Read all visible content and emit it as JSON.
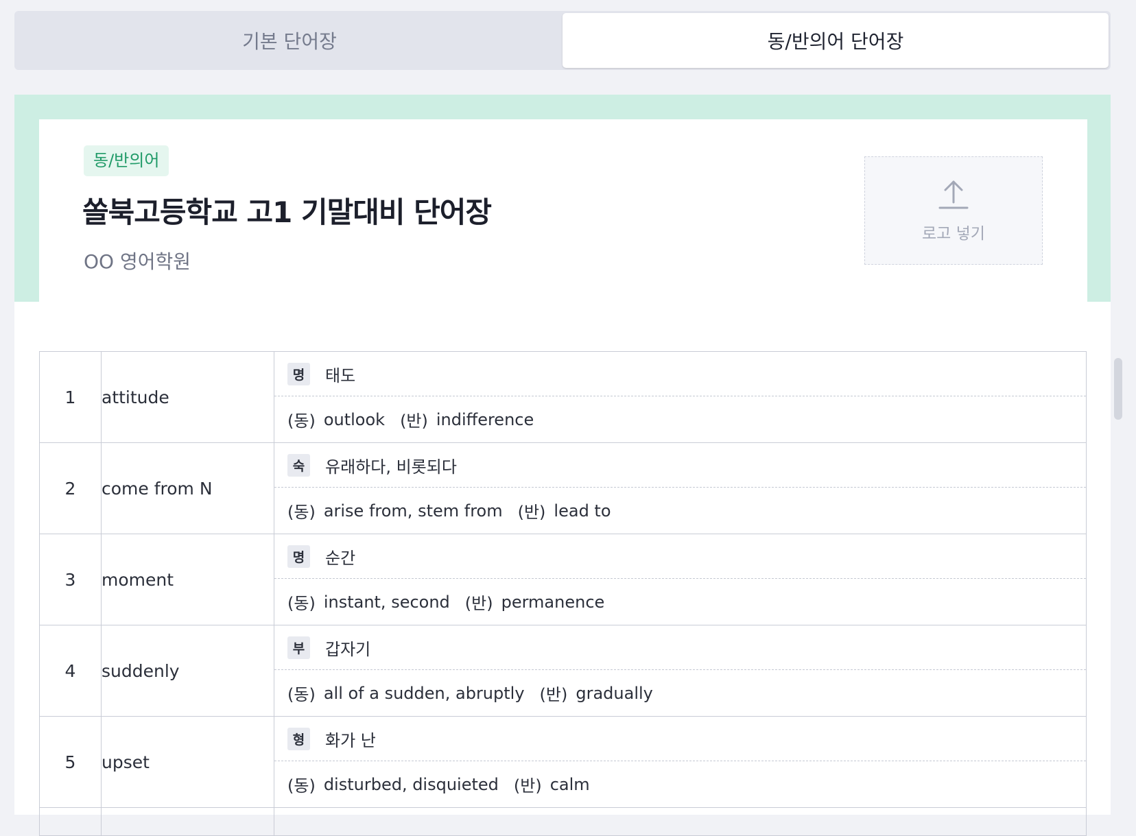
{
  "tabs": [
    {
      "label": "기본 단어장",
      "active": false
    },
    {
      "label": "동/반의어 단어장",
      "active": true
    }
  ],
  "header": {
    "badge": "동/반의어",
    "title": "쏠북고등학교 고1 기말대비 단어장",
    "academy": "OO 영어학원",
    "logo_label": "로고 넣기",
    "logo_icon": "upload-icon"
  },
  "labels": {
    "synonym": "(동)",
    "antonym": "(반)"
  },
  "colors": {
    "accent": "#1f9a67",
    "band": "#cdeee3",
    "badge_bg": "#e5f6ef"
  },
  "rows": [
    {
      "num": "1",
      "word": "attitude",
      "pos": "명",
      "meaning": "태도",
      "syn": "outlook",
      "ant": "indifference"
    },
    {
      "num": "2",
      "word": "come from N",
      "pos": "숙",
      "meaning": "유래하다, 비롯되다",
      "syn": "arise from, stem from",
      "ant": "lead to"
    },
    {
      "num": "3",
      "word": "moment",
      "pos": "명",
      "meaning": "순간",
      "syn": "instant, second",
      "ant": "permanence"
    },
    {
      "num": "4",
      "word": "suddenly",
      "pos": "부",
      "meaning": "갑자기",
      "syn": "all of a sudden, abruptly",
      "ant": "gradually"
    },
    {
      "num": "5",
      "word": "upset",
      "pos": "형",
      "meaning": "화가 난",
      "syn": "disturbed, disquieted",
      "ant": "calm"
    }
  ]
}
